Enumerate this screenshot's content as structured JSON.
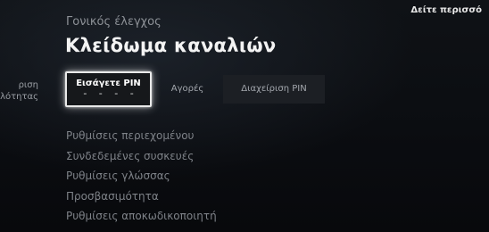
{
  "header": {
    "top_link": "Δείτε περισσό",
    "breadcrumb": "Γονικός έλεγχος",
    "title": "Κλείδωμα καναλιών"
  },
  "tabs": {
    "partial_left_line1": "ριση",
    "partial_left_line2": "λότητας",
    "enter_pin_label": "Εισάγετε PIN",
    "enter_pin_dots": "- - - -",
    "purchases_label": "Αγορές",
    "manage_pin_label": "Διαχείριση PIN"
  },
  "menu": {
    "items": [
      "Ρυθμίσεις περιεχομένου",
      "Συνδεδεμένες συσκευές",
      "Ρυθμίσεις γλώσσας",
      "Προσβασιμότητα",
      "Ρυθμίσεις αποκωδικοποιητή"
    ]
  }
}
